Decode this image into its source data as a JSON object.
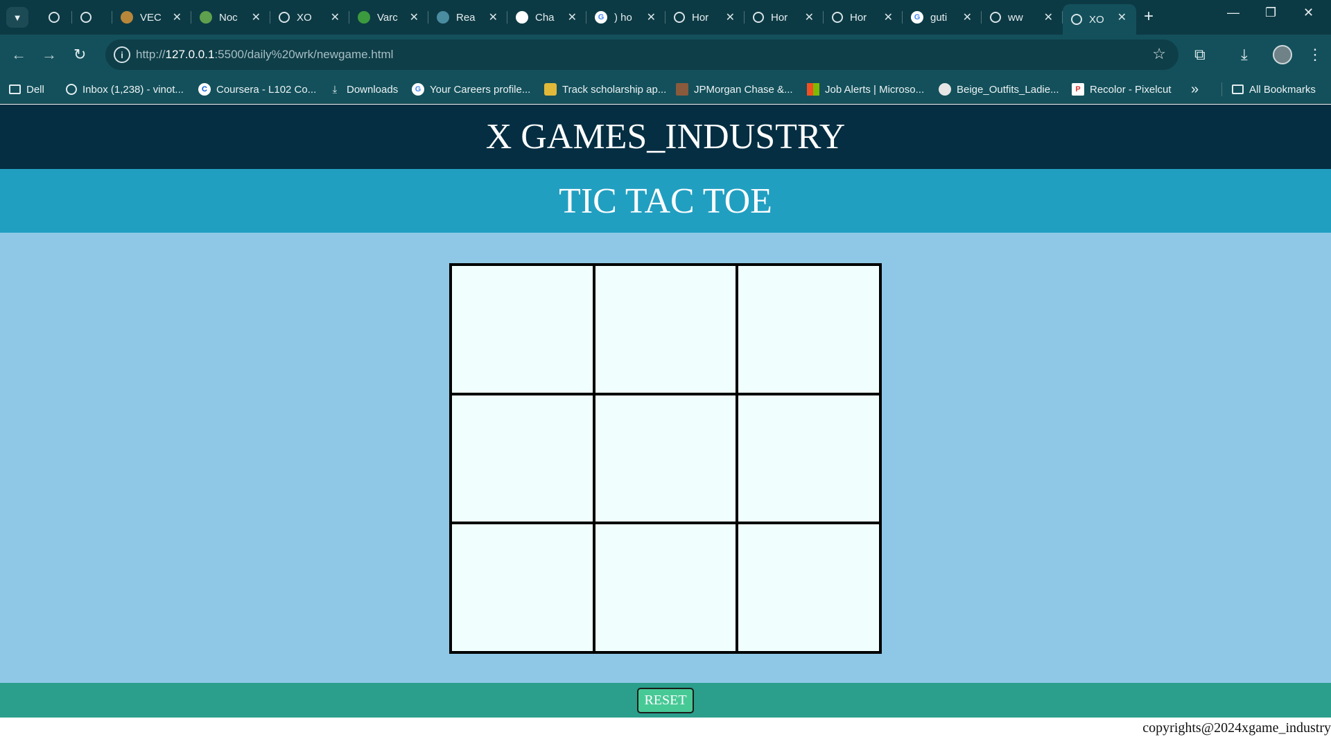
{
  "browser": {
    "tabs": [
      {
        "title": "",
        "favicon": "globe-icon",
        "color": "#2f6c78"
      },
      {
        "title": "",
        "favicon": "globe-icon",
        "color": "#2f6c78"
      },
      {
        "title": "VEC",
        "favicon": "college-logo-icon",
        "color": "#b8873a"
      },
      {
        "title": "Noc",
        "favicon": "nodejs-icon",
        "color": "#5fa04e"
      },
      {
        "title": "XO",
        "favicon": "globe-icon",
        "color": "#2f6c78"
      },
      {
        "title": "Varc",
        "favicon": "leaf-icon",
        "color": "#3c9a3e"
      },
      {
        "title": "Rea",
        "favicon": "react-icon",
        "color": "#4a8ca0"
      },
      {
        "title": "Cha",
        "favicon": "chatgpt-icon",
        "color": "#ffffff"
      },
      {
        "title": ") ho",
        "favicon": "google-icon",
        "color": "#ffffff"
      },
      {
        "title": "Hor",
        "favicon": "globe-icon",
        "color": "#2f6c78"
      },
      {
        "title": "Hor",
        "favicon": "globe-icon",
        "color": "#2f6c78"
      },
      {
        "title": "Hor",
        "favicon": "globe-icon",
        "color": "#2f6c78"
      },
      {
        "title": "guti",
        "favicon": "google-icon",
        "color": "#ffffff"
      },
      {
        "title": "ww",
        "favicon": "globe-icon",
        "color": "#2f6c78"
      },
      {
        "title": "XO",
        "favicon": "globe-icon",
        "color": "#2f6c78",
        "active": true
      }
    ],
    "url_prefix": "http://",
    "url_host": "127.0.0.1",
    "url_rest": ":5500/daily%20wrk/newgame.html",
    "bookmarks": [
      {
        "label": "Dell",
        "icon": "folder-icon"
      },
      {
        "label": "Inbox (1,238) - vinot...",
        "icon": "globe-icon"
      },
      {
        "label": "Coursera - L102 Co...",
        "icon": "coursera-icon"
      },
      {
        "label": "Downloads",
        "icon": "download-icon"
      },
      {
        "label": "Your Careers profile...",
        "icon": "google-icon"
      },
      {
        "label": "Track scholarship ap...",
        "icon": "scholarship-icon"
      },
      {
        "label": "JPMorgan Chase &...",
        "icon": "jpmorgan-icon"
      },
      {
        "label": "Job Alerts | Microso...",
        "icon": "microsoft-icon"
      },
      {
        "label": "Beige_Outfits_Ladie...",
        "icon": "image-icon"
      },
      {
        "label": "Recolor - Pixelcut",
        "icon": "pixelcut-icon"
      }
    ],
    "all_bookmarks": "All Bookmarks"
  },
  "page": {
    "brand": "X GAMES_INDUSTRY",
    "game_title": "TIC TAC TOE",
    "board": [
      "",
      "",
      "",
      "",
      "",
      "",
      "",
      "",
      ""
    ],
    "reset_label": "RESET",
    "copyright": "copyrights@2024xgame_industry"
  },
  "colors": {
    "brand_bar": "#052e42",
    "title_bar": "#219fc1",
    "page_bg": "#8fc8e6",
    "cell_bg": "#f0fffe",
    "reset_bar": "#2b9e8c",
    "reset_button": "#47c996"
  }
}
